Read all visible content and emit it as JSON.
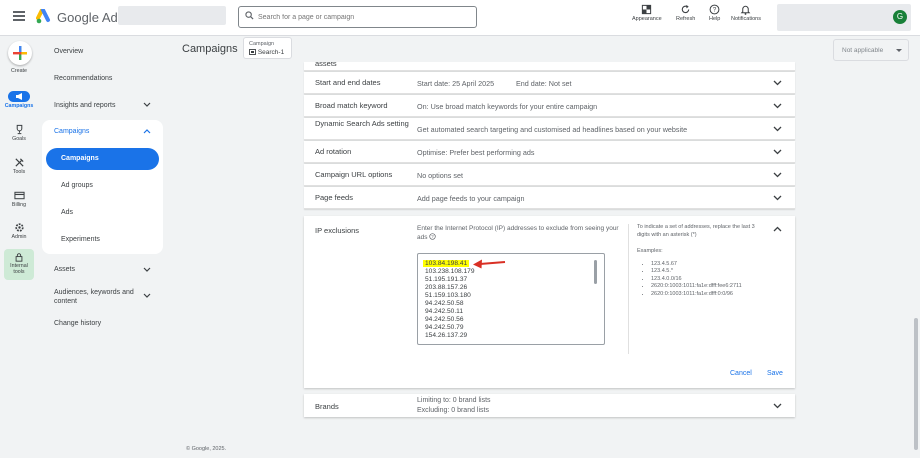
{
  "header": {
    "logo_text": "Google Ads",
    "search_placeholder": "Search for a page or campaign",
    "tools": [
      {
        "label": "Appearance",
        "icon": "appearance-icon"
      },
      {
        "label": "Refresh",
        "icon": "refresh-icon"
      },
      {
        "label": "Help",
        "icon": "help-icon"
      },
      {
        "label": "Notifications",
        "icon": "bell-icon"
      }
    ],
    "avatar_initial": "G"
  },
  "rail": {
    "create": "Create",
    "items": [
      "Campaigns",
      "Goals",
      "Tools",
      "Billing",
      "Admin",
      "Internal tools"
    ]
  },
  "nav": {
    "overview": "Overview",
    "recommendations": "Recommendations",
    "insights": "Insights and reports",
    "campaigns_group": "Campaigns",
    "campaigns": "Campaigns",
    "ad_groups": "Ad groups",
    "ads": "Ads",
    "experiments": "Experiments",
    "assets": "Assets",
    "audiences": "Audiences, keywords and content",
    "change_history": "Change history"
  },
  "main": {
    "page_title": "Campaigns",
    "campaign_chip": {
      "label": "Campaign",
      "value": "Search-1"
    },
    "not_applicable": "Not applicable",
    "truncated_row": "assets",
    "settings": [
      {
        "label": "Start and end dates",
        "value": "Start date: 25 April 2025",
        "value2": "End date: Not set"
      },
      {
        "label": "Broad match keyword",
        "value": "On: Use broad match keywords for your entire campaign"
      },
      {
        "label": "Dynamic Search Ads setting",
        "value": "Get automated search targeting and customised ad headlines based on your website"
      },
      {
        "label": "Ad rotation",
        "value": "Optimise: Prefer best performing ads"
      },
      {
        "label": "Campaign URL options",
        "value": "No options set"
      },
      {
        "label": "Page feeds",
        "value": "Add page feeds to your campaign"
      }
    ],
    "ip_exclusions": {
      "title": "IP exclusions",
      "description": "Enter the Internet Protocol (IP) addresses to exclude from seeing your ads",
      "addresses": [
        "103.84.198.41",
        "103.238.108.179",
        "51.195.191.37",
        "203.88.157.26",
        "51.159.103.180",
        "94.242.50.58",
        "94.242.50.11",
        "94.242.50.56",
        "94.242.50.79",
        "154.26.137.29"
      ],
      "hint": "To indicate a set of addresses, replace the last 3 digits with an asterisk (*)",
      "examples_title": "Examples:",
      "examples": [
        "123.4.5.67",
        "123.4.5.*",
        "123.4.0.0/16",
        "2620:0:1003:1011:fa1e:dfff:fee6:2711",
        "2620:0:1003:1011:fa1e:dfff:0:0/96"
      ],
      "cancel": "Cancel",
      "save": "Save"
    },
    "brands": {
      "label": "Brands",
      "limiting": "Limiting to: 0 brand lists",
      "excluding": "Excluding: 0 brand lists"
    },
    "footer": "© Google, 2025."
  }
}
